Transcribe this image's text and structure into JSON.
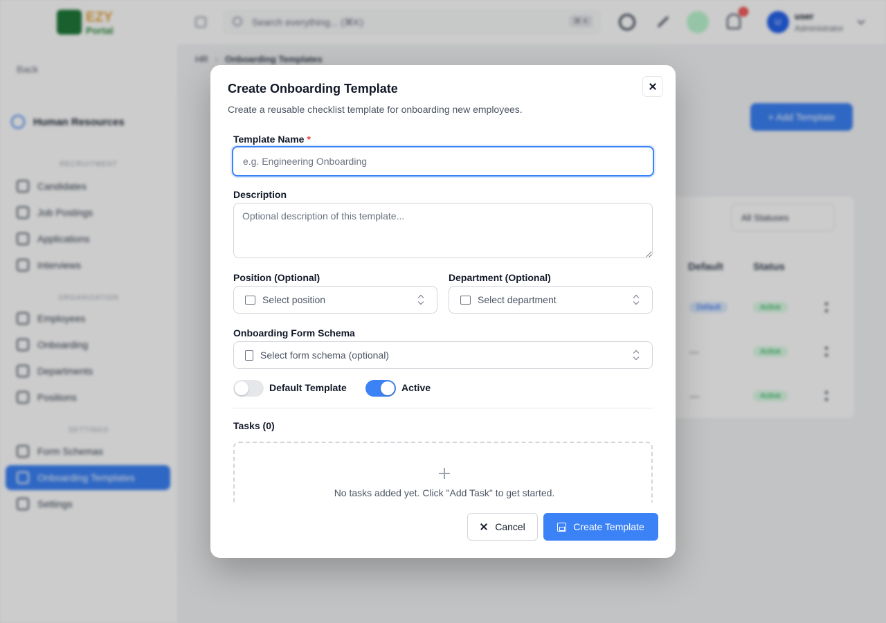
{
  "topbar": {
    "logo_line1": "EZY",
    "logo_line2": "Portal",
    "search_placeholder": "Search everything... (⌘K)",
    "search_shortcut": "⌘ K",
    "notification_count": "1",
    "avatar_initial": "U",
    "user_name": "user",
    "user_role": "Administrator"
  },
  "sidebar": {
    "back_label": "Back",
    "section_title": "Human Resources",
    "groups": {
      "recruitment": "RECRUITMENT",
      "organization": "ORGANIZATION",
      "settings": "SETTINGS"
    },
    "items": [
      {
        "label": "Candidates",
        "icon": "users-icon"
      },
      {
        "label": "Job Postings",
        "icon": "briefcase-icon"
      },
      {
        "label": "Applications",
        "icon": "file-icon"
      },
      {
        "label": "Interviews",
        "icon": "calendar-icon"
      },
      {
        "label": "Employees",
        "icon": "user-plus-icon"
      },
      {
        "label": "Onboarding",
        "icon": "clipboard-icon"
      },
      {
        "label": "Departments",
        "icon": "building-icon"
      },
      {
        "label": "Positions",
        "icon": "briefcase-icon"
      },
      {
        "label": "Form Schemas",
        "icon": "document-icon"
      },
      {
        "label": "Onboarding Templates",
        "icon": "list-icon"
      },
      {
        "label": "Settings",
        "icon": "gear-icon"
      }
    ]
  },
  "background": {
    "breadcrumb_root": "HR",
    "breadcrumb_current": "Onboarding Templates",
    "add_template_label": "+ Add Template",
    "status_filter": "All Statuses",
    "col_default": "Default",
    "col_status": "Status",
    "rows": [
      {
        "default": "Default",
        "status": "Active"
      },
      {
        "default": "—",
        "status": "Active"
      },
      {
        "default": "—",
        "status": "Active"
      }
    ]
  },
  "modal": {
    "title": "Create Onboarding Template",
    "description": "Create a reusable checklist template for onboarding new employees.",
    "template_name": {
      "label": "Template Name",
      "required_mark": "*",
      "placeholder": "e.g. Engineering Onboarding",
      "value": ""
    },
    "description_field": {
      "label": "Description",
      "placeholder": "Optional description of this template...",
      "value": ""
    },
    "position": {
      "label": "Position (Optional)",
      "value": "Select position"
    },
    "department": {
      "label": "Department (Optional)",
      "value": "Select department"
    },
    "form_schema": {
      "label": "Onboarding Form Schema",
      "value": "Select form schema (optional)"
    },
    "default_toggle": {
      "label": "Default Template",
      "on": false
    },
    "active_toggle": {
      "label": "Active",
      "on": true
    },
    "tasks_heading": "Tasks (0)",
    "tasks_empty": "No tasks added yet. Click \"Add Task\" to get started.",
    "cancel_label": "Cancel",
    "create_label": "Create Template"
  },
  "colors": {
    "accent": "#3b82f6",
    "required": "#ef4444",
    "active_badge": "#16a34a"
  }
}
